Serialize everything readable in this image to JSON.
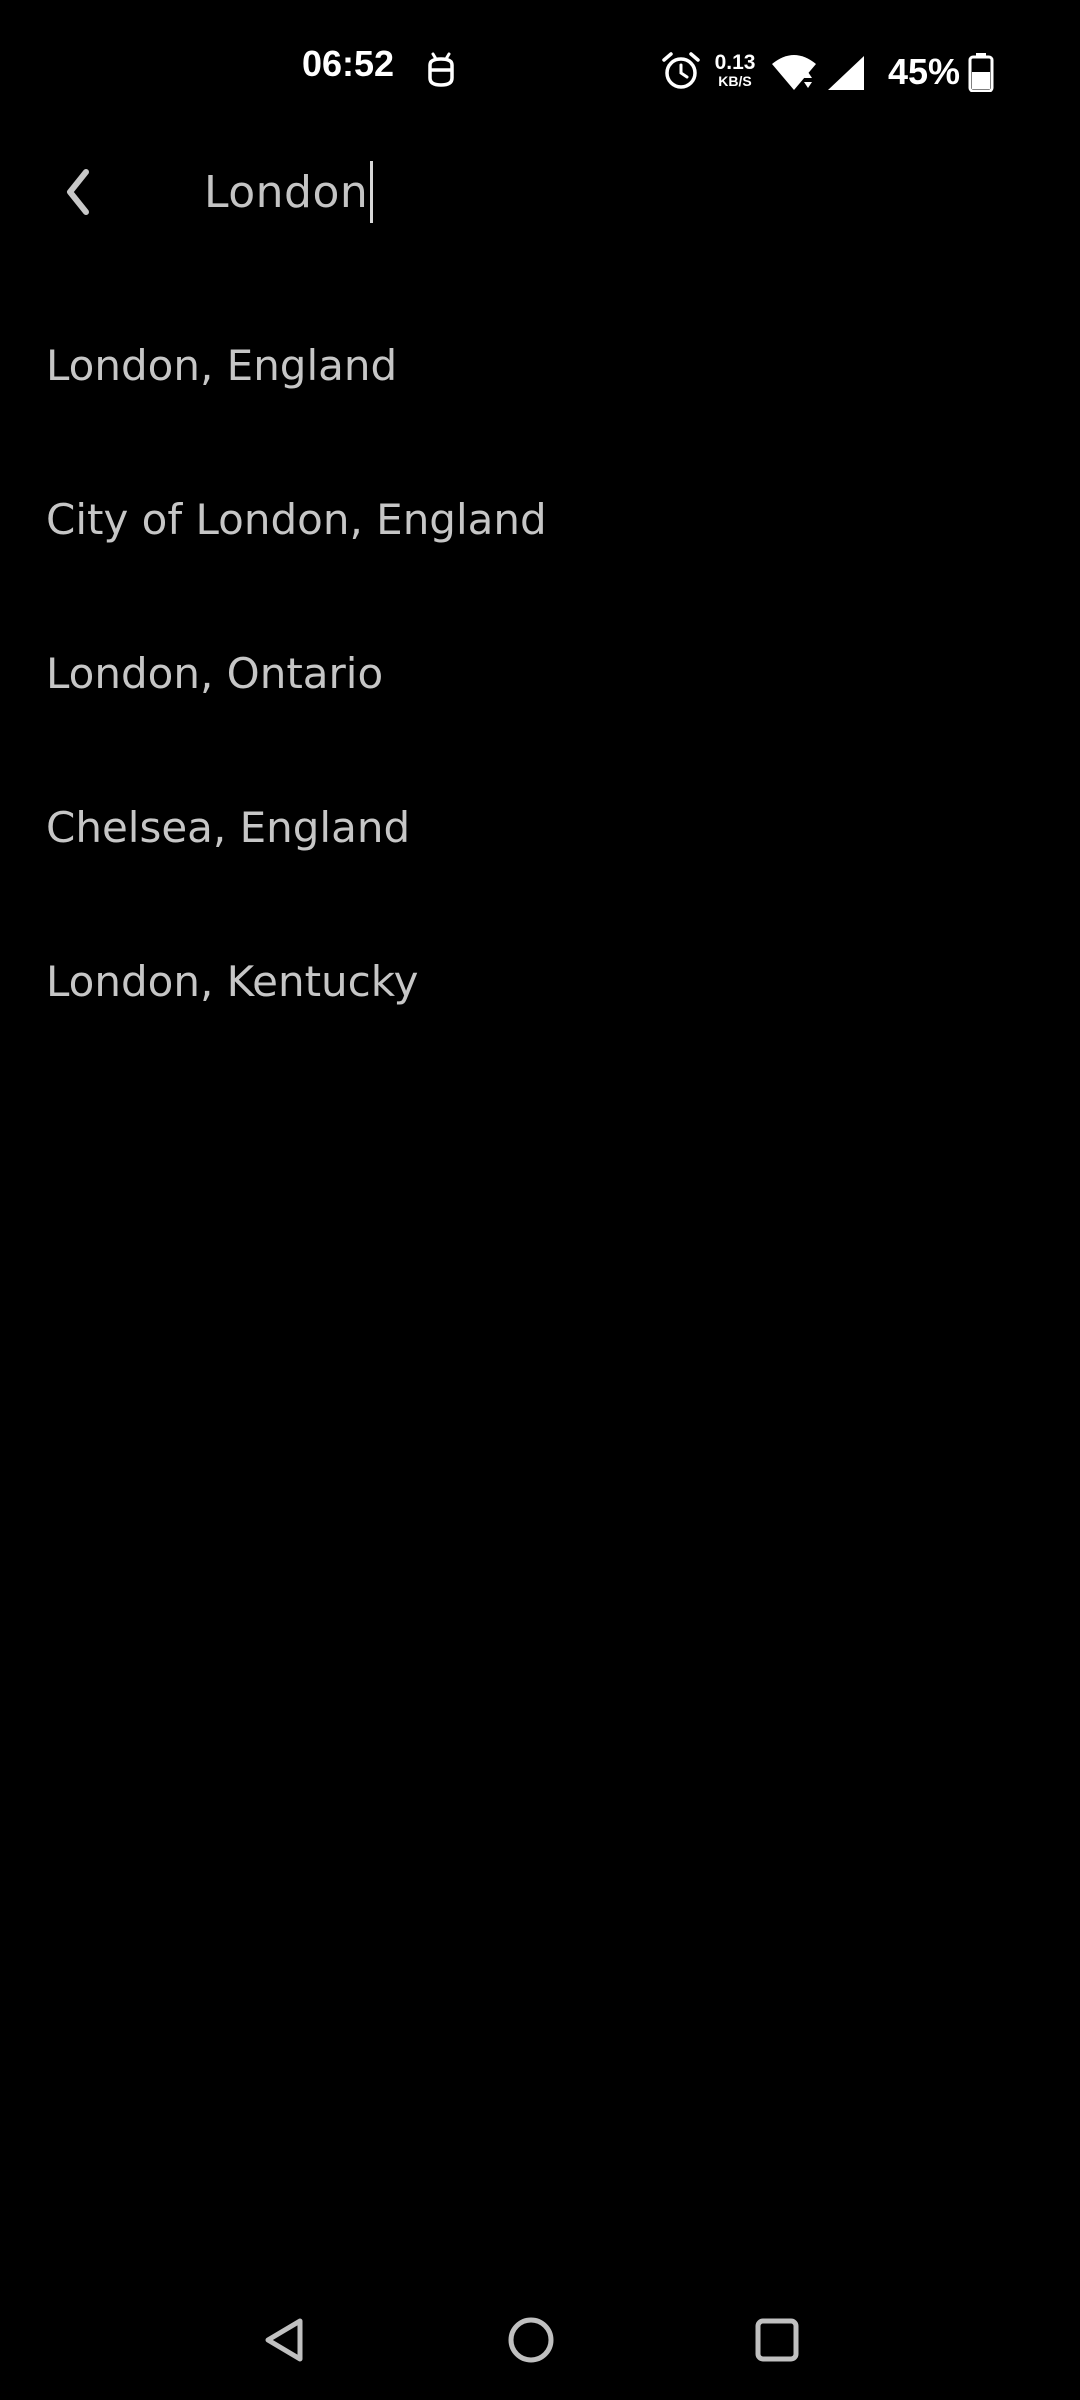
{
  "status_bar": {
    "time": "06:52",
    "net_speed_value": "0.13",
    "net_speed_unit": "KB/S",
    "battery_percent": "45%",
    "icons": [
      "robot-notification-icon",
      "alarm-icon",
      "wifi-icon",
      "cell-signal-icon",
      "battery-icon"
    ]
  },
  "search": {
    "query": "London",
    "back_icon": "chevron-left-icon"
  },
  "results": [
    "London, England",
    "City of London, England",
    "London, Ontario",
    "Chelsea, England",
    "London, Kentucky"
  ],
  "nav_bar": {
    "icons": [
      "back-triangle-icon",
      "home-circle-icon",
      "recents-square-icon"
    ]
  },
  "colors": {
    "background": "#000000",
    "text": "#c6c6c6",
    "status_text": "#ffffff"
  }
}
